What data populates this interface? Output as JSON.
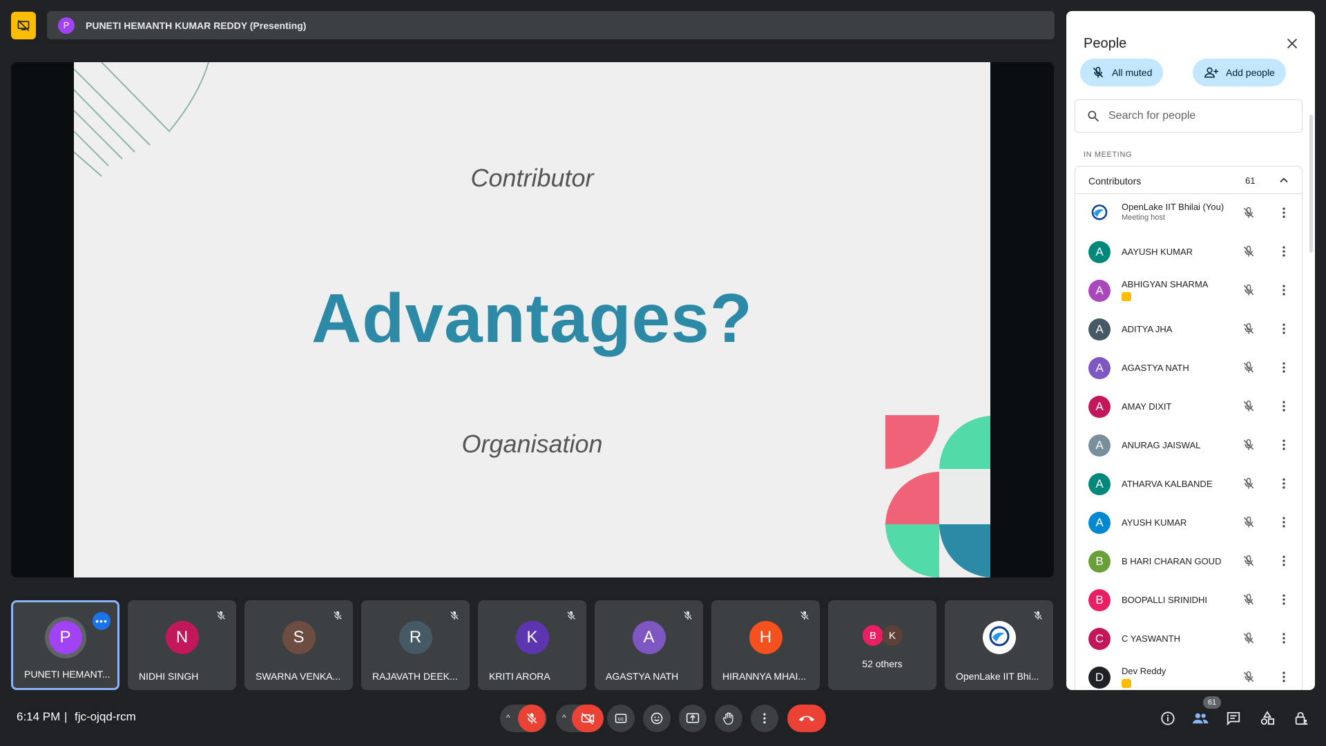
{
  "presenter": {
    "initial": "P",
    "label": "PUNETI HEMANTH KUMAR REDDY (Presenting)"
  },
  "slide": {
    "top_text": "Contributor",
    "title": "Advantages?",
    "bottom_text": "Organisation"
  },
  "tiles": [
    {
      "initial": "P",
      "name": "PUNETI HEMANT...",
      "color": "#a142f4",
      "active": true,
      "more_label": "•••"
    },
    {
      "initial": "N",
      "name": "NIDHI SINGH",
      "color": "#c2185b"
    },
    {
      "initial": "S",
      "name": "SWARNA VENKA...",
      "color": "#6d4c41"
    },
    {
      "initial": "R",
      "name": "RAJAVATH DEEK...",
      "color": "#455a64"
    },
    {
      "initial": "K",
      "name": "KRITI ARORA",
      "color": "#5e35b1"
    },
    {
      "initial": "A",
      "name": "AGASTYA NATH",
      "color": "#7e57c2"
    },
    {
      "initial": "H",
      "name": "HIRANNYA MHAI...",
      "color": "#f4511e"
    },
    {
      "others_label": "52 others",
      "mini": [
        {
          "initial": "B",
          "color": "#e91e63"
        },
        {
          "initial": "K",
          "color": "#5d4037"
        }
      ]
    },
    {
      "name": "OpenLake IIT Bhi...",
      "logo": true
    }
  ],
  "bottom": {
    "time": "6:14 PM",
    "separator": "|",
    "meeting_code": "fjc-ojqd-rcm",
    "people_count": "61"
  },
  "panel": {
    "title": "People",
    "all_muted": "All muted",
    "add_people": "Add people",
    "search_placeholder": "Search for people",
    "in_meeting": "IN MEETING",
    "group_label": "Contributors",
    "group_count": "61",
    "people": [
      {
        "name": "OpenLake IIT Bhilai (You)",
        "sub": "Meeting host",
        "logo": true
      },
      {
        "initial": "A",
        "name": "AAYUSH KUMAR",
        "color": "#00897b"
      },
      {
        "initial": "A",
        "name": "ABHIGYAN SHARMA",
        "color": "#ab47bc",
        "presenting": true
      },
      {
        "initial": "A",
        "name": "ADITYA JHA",
        "color": "#455a64"
      },
      {
        "initial": "A",
        "name": "AGASTYA NATH",
        "color": "#7e57c2"
      },
      {
        "initial": "A",
        "name": "AMAY DIXIT",
        "color": "#c2185b"
      },
      {
        "initial": "A",
        "name": "ANURAG JAISWAL",
        "color": "#78909c"
      },
      {
        "initial": "A",
        "name": "ATHARVA KALBANDE",
        "color": "#00897b"
      },
      {
        "initial": "A",
        "name": "AYUSH KUMAR",
        "color": "#0288d1"
      },
      {
        "initial": "B",
        "name": "B HARI CHARAN GOUD",
        "color": "#689f38"
      },
      {
        "initial": "B",
        "name": "BOOPALLI SRINIDHI",
        "color": "#e91e63"
      },
      {
        "initial": "C",
        "name": "C YASWANTH",
        "color": "#c2185b"
      },
      {
        "initial": "D",
        "name": "Dev Reddy",
        "color": "#202124",
        "presenting": true
      }
    ]
  },
  "colors": {
    "accent_blue": "#8ab4f8",
    "danger_red": "#ea4335",
    "pill_blue": "#c2e7ff",
    "slide_title": "#2d8aa6"
  }
}
